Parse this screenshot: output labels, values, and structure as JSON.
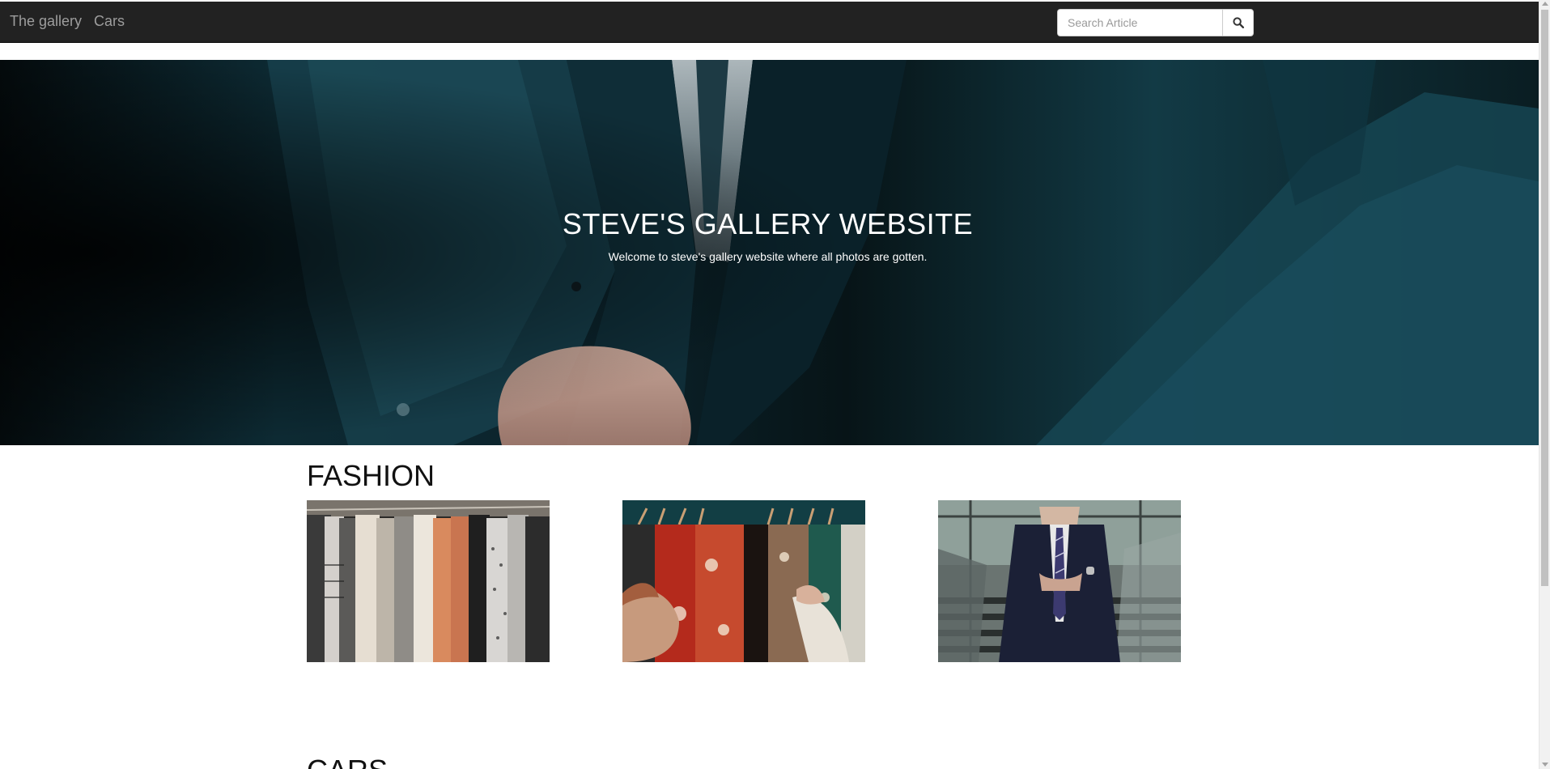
{
  "navbar": {
    "brand": "The gallery",
    "links": [
      "Cars"
    ],
    "search": {
      "placeholder": "Search Article",
      "button_icon": "search-icon"
    },
    "background": "#222222",
    "link_color": "#9d9d9d"
  },
  "hero": {
    "title": "STEVE'S GALLERY WEBSITE",
    "subtitle": "Welcome to steve's gallery website where all photos are gotten."
  },
  "sections": [
    {
      "title": "FASHION",
      "images": [
        {
          "name": "clothes-rack-photo"
        },
        {
          "name": "floral-shirts-photo"
        },
        {
          "name": "man-in-suit-photo"
        }
      ]
    },
    {
      "title": "CARS"
    }
  ]
}
